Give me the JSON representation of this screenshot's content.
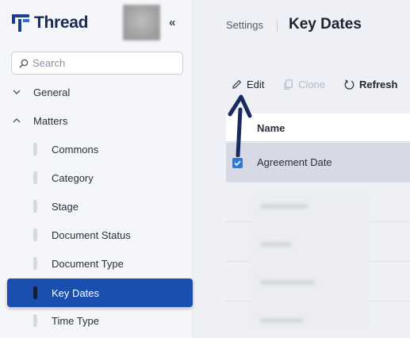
{
  "app": {
    "name": "Thread",
    "collapse_label": "«"
  },
  "search": {
    "placeholder": "Search"
  },
  "sidebar": {
    "groups": [
      {
        "label": "General",
        "expanded": false
      },
      {
        "label": "Matters",
        "expanded": true
      }
    ],
    "items": [
      {
        "label": "Commons"
      },
      {
        "label": "Category"
      },
      {
        "label": "Stage"
      },
      {
        "label": "Document Status"
      },
      {
        "label": "Document Type"
      },
      {
        "label": "Key Dates",
        "active": true
      },
      {
        "label": "Time Type"
      }
    ]
  },
  "header": {
    "breadcrumb": "Settings",
    "title": "Key Dates"
  },
  "toolbar": {
    "edit_label": "Edit",
    "clone_label": "Clone",
    "refresh_label": "Refresh"
  },
  "table": {
    "columns": [
      "Name"
    ],
    "rows": [
      {
        "name": "Agreement Date",
        "selected": true
      }
    ]
  },
  "icons": [
    "search-icon",
    "chevron-down-icon",
    "chevron-up-icon",
    "pencil-icon",
    "copy-icon",
    "refresh-icon",
    "checkmark-icon",
    "arrow-up-annotation"
  ],
  "colors": {
    "accent": "#1a4fb0",
    "brand": "#1b3f8f",
    "checkbox": "#2a78e0",
    "annotation_arrow": "#1a2a5e"
  }
}
